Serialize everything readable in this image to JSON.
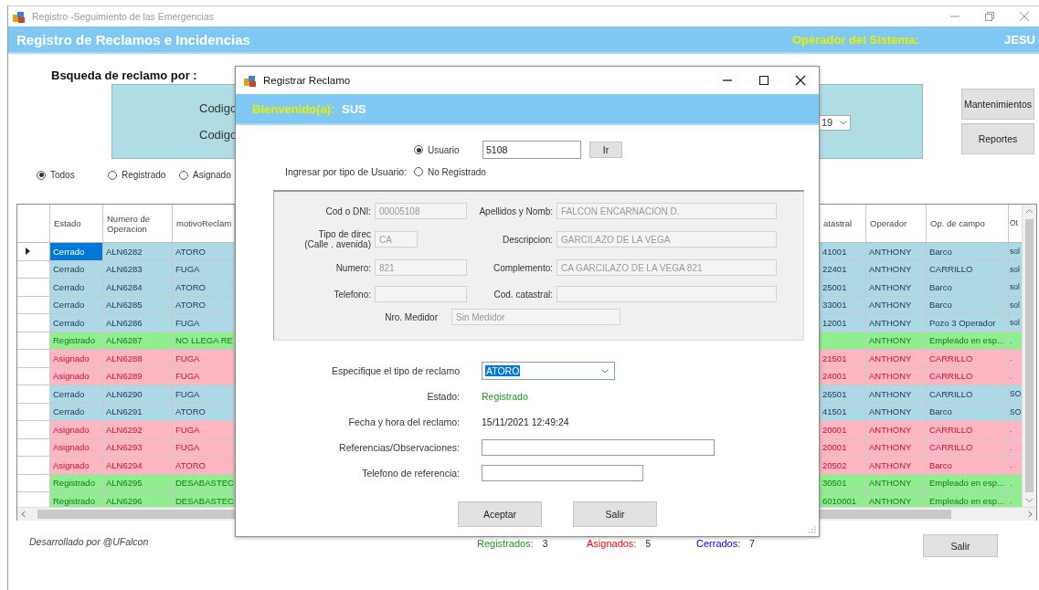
{
  "window": {
    "title": "Registro -Seguimiento de las Emergencias"
  },
  "header": {
    "title": "Registro de Reclamos e Incidencias",
    "operator_label": "Operador del Sistema:",
    "operator_name": "JESU"
  },
  "search": {
    "heading": "Bsqueda de reclamo por :",
    "labels": [
      "Codigo",
      "Codigo"
    ],
    "dropdown_value": "19"
  },
  "side_buttons": [
    "Mantenimientos",
    "Reportes"
  ],
  "filters": [
    {
      "label": "Todos",
      "selected": true
    },
    {
      "label": "Registrado",
      "selected": false
    },
    {
      "label": "Asignado",
      "selected": false
    }
  ],
  "table": {
    "columns": [
      "Estado",
      "Numero de Operacion",
      "motivoReclam",
      "atastral",
      "Operador",
      "Op. de campo",
      "Ot"
    ],
    "rows": [
      {
        "cells": [
          "Cerrado",
          "ALN6282",
          "ATORO",
          "41001",
          "ANTHONY",
          "Barco",
          "sol"
        ],
        "color": "#add8e6",
        "kind": "closed",
        "selected": true
      },
      {
        "cells": [
          "Cerrado",
          "ALN6283",
          "FUGA",
          "22401",
          "ANTHONY",
          "CARRILLO",
          "sol"
        ],
        "color": "#add8e6",
        "kind": "closed",
        "selected": false
      },
      {
        "cells": [
          "Cerrado",
          "ALN6284",
          "ATORO",
          "25001",
          "ANTHONY",
          "Barco",
          "sol"
        ],
        "color": "#add8e6",
        "kind": "closed",
        "selected": false
      },
      {
        "cells": [
          "Cerrado",
          "ALN6285",
          "ATORO",
          "33001",
          "ANTHONY",
          "Barco",
          "sol"
        ],
        "color": "#add8e6",
        "kind": "closed",
        "selected": false
      },
      {
        "cells": [
          "Cerrado",
          "ALN6286",
          "FUGA",
          "12001",
          "ANTHONY",
          "Pozo 3 Operador",
          "sol"
        ],
        "color": "#add8e6",
        "kind": "closed",
        "selected": false
      },
      {
        "cells": [
          "Registrado",
          "ALN6287",
          "NO LLEGA RE",
          null,
          "ANTHONY",
          "Empleado en esp...",
          "."
        ],
        "color": "#90ee90",
        "kind": "registered",
        "selected": false
      },
      {
        "cells": [
          "Asignado",
          "ALN6288",
          "FUGA",
          "21501",
          "ANTHONY",
          "CARRILLO",
          "."
        ],
        "color": "#ffb6c1",
        "kind": "assigned",
        "selected": false
      },
      {
        "cells": [
          "Asignado",
          "ALN6289",
          "FUGA",
          "24001",
          "ANTHONY",
          "CARRILLO",
          "."
        ],
        "color": "#ffb6c1",
        "kind": "assigned",
        "selected": false
      },
      {
        "cells": [
          "Cerrado",
          "ALN6290",
          "FUGA",
          "26501",
          "ANTHONY",
          "CARRILLO",
          "SO"
        ],
        "color": "#add8e6",
        "kind": "closed",
        "selected": false
      },
      {
        "cells": [
          "Cerrado",
          "ALN6291",
          "ATORO",
          "41501",
          "ANTHONY",
          "Barco",
          "SO"
        ],
        "color": "#add8e6",
        "kind": "closed",
        "selected": false
      },
      {
        "cells": [
          "Asignado",
          "ALN6292",
          "FUGA",
          "20001",
          "ANTHONY",
          "CARRILLO",
          "."
        ],
        "color": "#ffb6c1",
        "kind": "assigned",
        "selected": false
      },
      {
        "cells": [
          "Asignado",
          "ALN6293",
          "FUGA",
          "20001",
          "ANTHONY",
          "CARRILLO",
          "."
        ],
        "color": "#ffb6c1",
        "kind": "assigned",
        "selected": false
      },
      {
        "cells": [
          "Asignado",
          "ALN6294",
          "ATORO",
          "20502",
          "ANTHONY",
          "Barco",
          "."
        ],
        "color": "#ffb6c1",
        "kind": "assigned",
        "selected": false
      },
      {
        "cells": [
          "Registrado",
          "ALN6295",
          "DESABASTEC",
          "30501",
          "ANTHONY",
          "Empleado en esp...",
          "."
        ],
        "color": "#90ee90",
        "kind": "registered",
        "selected": false
      },
      {
        "cells": [
          "Registrado",
          "ALN6296",
          "DESABASTEC",
          "6010001",
          "ANTHONY",
          "Empleado en esp...",
          "."
        ],
        "color": "#90ee90",
        "kind": "registered",
        "selected": false
      }
    ]
  },
  "footer": {
    "credit": "Desarrollado por @UFalcon",
    "counters": [
      {
        "label": "Registrados:",
        "value": "3",
        "color": "#1a9a1a"
      },
      {
        "label": "Asignados:",
        "value": "5",
        "color": "#ff0000"
      },
      {
        "label": "Cerrados:",
        "value": "7",
        "color": "#0000ff"
      }
    ],
    "exit_button": "Salir"
  },
  "dialog": {
    "title": "Registrar Reclamo",
    "welcome_label": "Bienvenido(a):",
    "user_name": "SUS",
    "user_type_label": "Ingresar por tipo de Usuario:",
    "user_types": [
      {
        "label": "Usuario",
        "selected": true
      },
      {
        "label": "No Registrado",
        "selected": false
      }
    ],
    "user_code": "5108",
    "go_button": "Ir",
    "left_fields": [
      {
        "label": "Cod o DNI:",
        "value": "00005108"
      },
      {
        "label": "Tipo de direc\n(Calle . avenida)",
        "value": "CA"
      },
      {
        "label": "Numero:",
        "value": "821"
      },
      {
        "label": "Telefono:"
      }
    ],
    "right_fields": [
      {
        "label": "Apellidos y Nomb:",
        "value": "FALCON ENCARNACION D."
      },
      {
        "label": "Descripcion:",
        "value": "GARCILAZO DE LA VEGA"
      },
      {
        "label": "Complemento:",
        "value": "CA GARCILAZO DE LA VEGA 821"
      },
      {
        "label": "Cod. catastral:"
      }
    ],
    "meter": {
      "label": "Nro. Medidor",
      "value": "Sin Medidor"
    },
    "claim_type": {
      "label": "Especifique el tipo de reclamo",
      "value": "ATORO"
    },
    "status": {
      "label": "Estado:",
      "value": "Registrado"
    },
    "date": {
      "label": "Fecha y hora del reclamo:",
      "value": "15/11/2021 12:49:24"
    },
    "notes": {
      "label": "Referencias/Observaciones:"
    },
    "reference_phone": {
      "label": "Telefono de referencia:"
    },
    "buttons": [
      "Aceptar",
      "Salir"
    ]
  }
}
